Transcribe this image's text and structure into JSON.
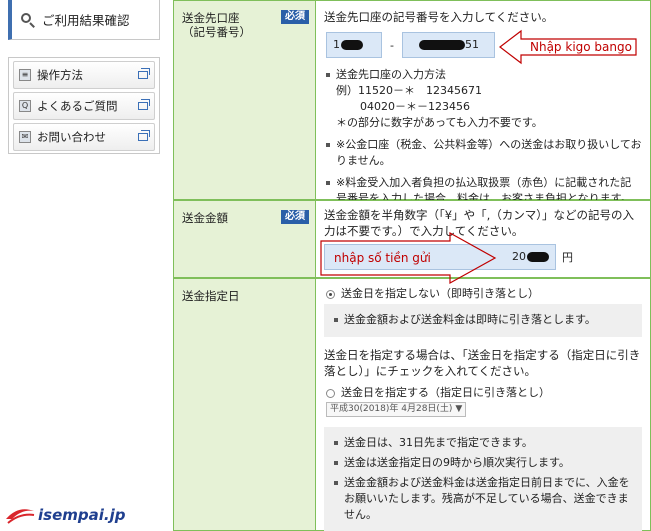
{
  "sidebar": {
    "result_label": "ご利用結果確認",
    "links": [
      {
        "label": "操作方法",
        "icon": "book-icon"
      },
      {
        "label": "よくあるご質問",
        "icon": "qa-icon"
      },
      {
        "label": "お問い合わせ",
        "icon": "mail-icon"
      }
    ]
  },
  "form": {
    "required_badge": "必須",
    "account": {
      "label": "送金先口座\n（記号番号）",
      "instruction": "送金先口座の記号番号を入力してください。",
      "symbol_visible": "1",
      "dash": "-",
      "number_visible": "51",
      "notes_title": "送金先口座の入力方法",
      "example_1": "例）11520－＊　12345671",
      "example_2": "04020－＊－123456",
      "example_3": "＊の部分に数字があっても入力不要です。",
      "note_public": "※公金口座（税金、公共料金等）への送金はお取り扱いしておりません。",
      "note_fee": "※料金受入加入者負担の払込取扱票（赤色）に記載された記号番号を入力した場合、料金は、お客さま負担となります。"
    },
    "amount": {
      "label": "送金金額",
      "instruction": "送金金額を半角数字（「¥」や「,（カンマ）」などの記号の入力は不要です。）で入力してください。",
      "value_visible": "20",
      "unit": "円"
    },
    "date": {
      "label": "送金指定日",
      "option_none": "送金日を指定しない（即時引き落とし）",
      "option_none_note": "送金金額および送金料金は即時に引き落とします。",
      "specify_text": "送金日を指定する場合は、「送金日を指定する（指定日に引き落とし）」にチェックを入れてください。",
      "option_specify": "送金日を指定する（指定日に引き落とし）",
      "date_select": "平成30(2018)年 4月28日(土)",
      "notes": [
        "送金日は、31日先まで指定できます。",
        "送金は送金指定日の9時から順次実行します。",
        "送金金額および送金料金は送金指定日前日までに、入金をお願いいたします。残高が不足している場合、送金できません。"
      ]
    }
  },
  "annotations": {
    "kigo": "Nhập kigo bango",
    "amount": "nhập số tiền gửi"
  },
  "logo": {
    "text": "isempai.jp"
  },
  "colors": {
    "label_bg": "#e6f2d6",
    "border": "#7fbf5a",
    "badge": "#2a5fa8",
    "input_bg": "#dbe8f7",
    "annotation": "#c00000"
  }
}
